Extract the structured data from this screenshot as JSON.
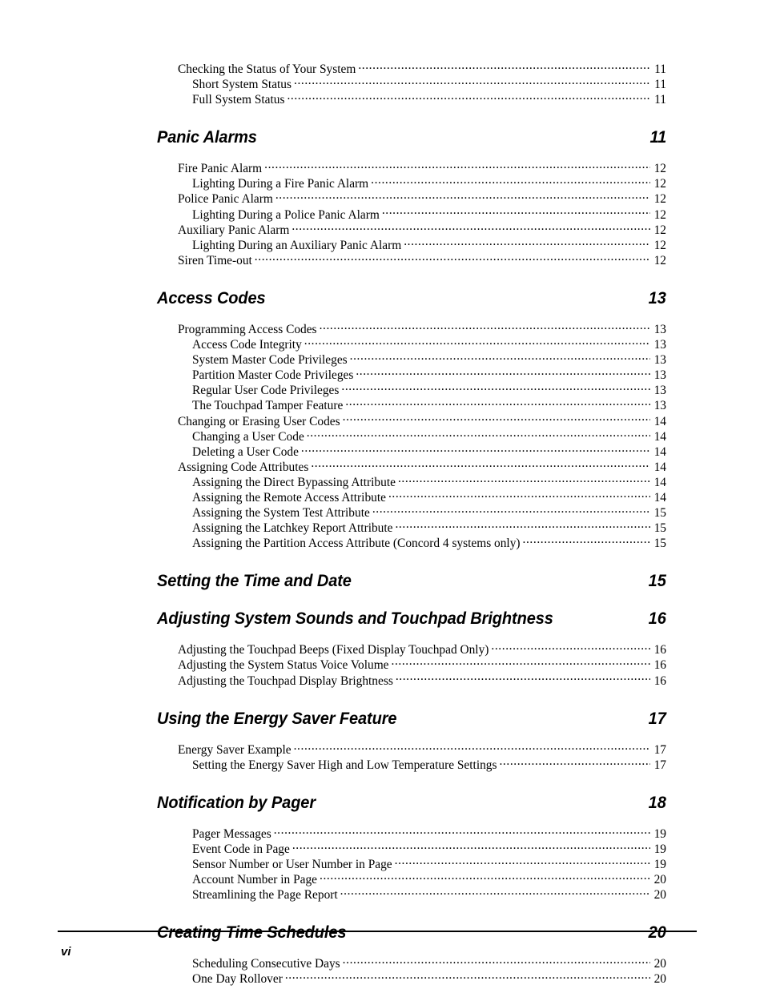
{
  "document": {
    "type": "table-of-contents",
    "footer_page_label": "vi"
  },
  "toc": {
    "blocks": [
      {
        "kind": "entries",
        "items": [
          {
            "level": 1,
            "title": "Checking the Status of Your System",
            "page": "11"
          },
          {
            "level": 2,
            "title": "Short System Status",
            "page": "11"
          },
          {
            "level": 2,
            "title": "Full System Status",
            "page": "11"
          }
        ]
      },
      {
        "kind": "chapter",
        "title": "Panic Alarms",
        "page": "11"
      },
      {
        "kind": "entries",
        "items": [
          {
            "level": 1,
            "title": "Fire Panic Alarm",
            "page": "12"
          },
          {
            "level": 2,
            "title": "Lighting During a Fire Panic Alarm",
            "page": "12"
          },
          {
            "level": 1,
            "title": "Police Panic Alarm",
            "page": "12"
          },
          {
            "level": 2,
            "title": "Lighting During a Police Panic Alarm",
            "page": "12"
          },
          {
            "level": 1,
            "title": "Auxiliary Panic Alarm",
            "page": "12"
          },
          {
            "level": 2,
            "title": "Lighting During an Auxiliary Panic Alarm",
            "page": "12"
          },
          {
            "level": 1,
            "title": "Siren Time-out",
            "page": "12"
          }
        ]
      },
      {
        "kind": "chapter",
        "title": "Access Codes",
        "page": "13"
      },
      {
        "kind": "entries",
        "items": [
          {
            "level": 1,
            "title": "Programming Access Codes",
            "page": "13"
          },
          {
            "level": 2,
            "title": "Access Code Integrity",
            "page": "13"
          },
          {
            "level": 2,
            "title": "System Master Code Privileges",
            "page": "13"
          },
          {
            "level": 2,
            "title": "Partition Master Code Privileges",
            "page": "13"
          },
          {
            "level": 2,
            "title": "Regular User Code Privileges",
            "page": "13"
          },
          {
            "level": 2,
            "title": "The Touchpad Tamper Feature",
            "page": "13"
          },
          {
            "level": 1,
            "title": "Changing or Erasing User Codes",
            "page": "14"
          },
          {
            "level": 2,
            "title": "Changing a User Code",
            "page": "14"
          },
          {
            "level": 2,
            "title": "Deleting a User Code",
            "page": "14"
          },
          {
            "level": 1,
            "title": "Assigning Code Attributes",
            "page": "14"
          },
          {
            "level": 2,
            "title": "Assigning the Direct Bypassing Attribute",
            "page": "14"
          },
          {
            "level": 2,
            "title": "Assigning the Remote Access Attribute",
            "page": "14"
          },
          {
            "level": 2,
            "title": "Assigning the System Test Attribute",
            "page": "15"
          },
          {
            "level": 2,
            "title": "Assigning the Latchkey Report Attribute",
            "page": "15"
          },
          {
            "level": 2,
            "title": "Assigning the Partition Access Attribute (Concord 4 systems only)",
            "page": "15"
          }
        ]
      },
      {
        "kind": "chapter",
        "title": "Setting the Time and Date",
        "page": "15"
      },
      {
        "kind": "chapter",
        "title": "Adjusting System Sounds and Touchpad Brightness",
        "page": "16"
      },
      {
        "kind": "entries",
        "items": [
          {
            "level": 1,
            "title": "Adjusting the Touchpad Beeps (Fixed Display Touchpad Only)",
            "page": "16"
          },
          {
            "level": 1,
            "title": "Adjusting the System Status Voice Volume",
            "page": "16"
          },
          {
            "level": 1,
            "title": "Adjusting the Touchpad Display Brightness",
            "page": "16"
          }
        ]
      },
      {
        "kind": "chapter",
        "title": "Using the Energy Saver Feature",
        "page": "17"
      },
      {
        "kind": "entries",
        "items": [
          {
            "level": 1,
            "title": "Energy Saver Example",
            "page": "17"
          },
          {
            "level": 2,
            "title": "Setting the Energy Saver High and Low Temperature Settings",
            "page": "17"
          }
        ]
      },
      {
        "kind": "chapter",
        "title": "Notification by Pager",
        "page": "18"
      },
      {
        "kind": "entries",
        "items": [
          {
            "level": 2,
            "title": "Pager Messages",
            "page": "19"
          },
          {
            "level": 2,
            "title": "Event Code in Page",
            "page": "19"
          },
          {
            "level": 2,
            "title": "Sensor Number or User Number in Page",
            "page": "19"
          },
          {
            "level": 2,
            "title": "Account Number in Page",
            "page": "20"
          },
          {
            "level": 2,
            "title": "Streamlining the Page Report",
            "page": "20"
          }
        ]
      },
      {
        "kind": "chapter",
        "title": "Creating Time Schedules",
        "page": "20"
      },
      {
        "kind": "entries",
        "items": [
          {
            "level": 2,
            "title": "Scheduling Consecutive Days",
            "page": "20"
          },
          {
            "level": 2,
            "title": "One Day Rollover",
            "page": "20"
          }
        ]
      }
    ]
  }
}
